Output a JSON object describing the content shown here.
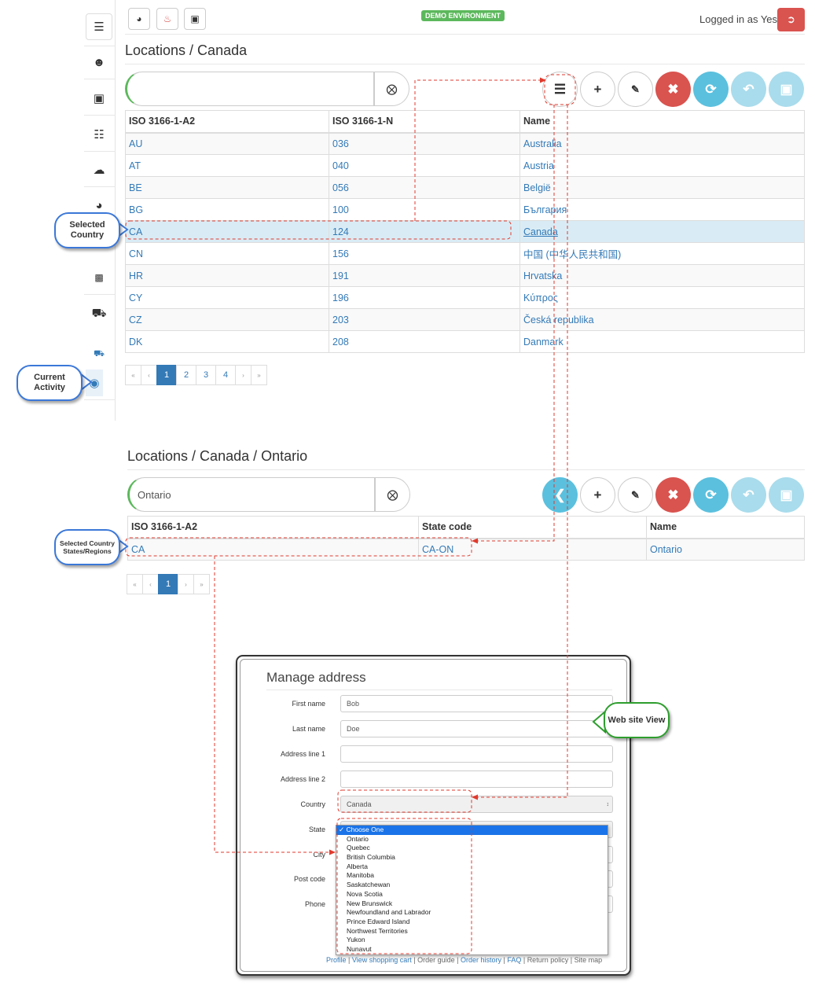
{
  "topbar": {
    "demo_badge": "DEMO ENVIRONMENT",
    "logged_in_text": "Logged in as Yes"
  },
  "countries_view": {
    "breadcrumb": "Locations / Canada",
    "search_value": "",
    "columns": [
      "ISO 3166-1-A2",
      "ISO 3166-1-N",
      "Name"
    ],
    "rows": [
      [
        "AU",
        "036",
        "Australia"
      ],
      [
        "AT",
        "040",
        "Austria"
      ],
      [
        "BE",
        "056",
        "België"
      ],
      [
        "BG",
        "100",
        "България"
      ],
      [
        "CA",
        "124",
        "Canada"
      ],
      [
        "CN",
        "156",
        "中国 (中华人民共和国)"
      ],
      [
        "HR",
        "191",
        "Hrvatska"
      ],
      [
        "CY",
        "196",
        "Κύπρος"
      ],
      [
        "CZ",
        "203",
        "Česká republika"
      ],
      [
        "DK",
        "208",
        "Danmark"
      ]
    ],
    "selected_row": 4,
    "pagination": {
      "first": "«",
      "prev": "‹",
      "pages": [
        "1",
        "2",
        "3",
        "4"
      ],
      "active": "1",
      "next": "›",
      "last": "»"
    }
  },
  "states_view": {
    "breadcrumb": "Locations / Canada / Ontario",
    "search_value": "Ontario",
    "columns": [
      "ISO 3166-1-A2",
      "State code",
      "Name"
    ],
    "rows": [
      [
        "CA",
        "CA-ON",
        "Ontario"
      ]
    ],
    "pagination": {
      "first": "«",
      "prev": "‹",
      "pages": [
        "1"
      ],
      "active": "1",
      "next": "›",
      "last": "»"
    }
  },
  "callouts": {
    "selected_country": "Selected Country",
    "current_activity": "Current Activity",
    "selected_country_states": "Selected Country States/Regions",
    "website_view": "Web site View"
  },
  "website": {
    "title": "Manage address",
    "fields": [
      {
        "label": "First name",
        "value": "Bob"
      },
      {
        "label": "Last name",
        "value": "Doe"
      },
      {
        "label": "Address line 1",
        "value": ""
      },
      {
        "label": "Address line 2",
        "value": ""
      },
      {
        "label": "Country",
        "value": "Canada"
      },
      {
        "label": "State",
        "value": ""
      },
      {
        "label": "City",
        "value": ""
      },
      {
        "label": "Post code",
        "value": ""
      },
      {
        "label": "Phone",
        "value": ""
      }
    ],
    "state_options": [
      "Choose One",
      "Ontario",
      "Quebec",
      "British Columbia",
      "Alberta",
      "Manitoba",
      "Saskatchewan",
      "Nova Scotia",
      "New Brunswick",
      "Newfoundland and Labrador",
      "Prince Edward Island",
      "Northwest Territories",
      "Yukon",
      "Nunavut"
    ],
    "selected_state_option": "Choose One",
    "footer_links": [
      "Profile",
      "View shopping cart",
      "Order guide",
      "Order history",
      "FAQ",
      "Return policy",
      "Site map"
    ]
  },
  "colors": {
    "primary": "#337ab7",
    "danger": "#d9534f",
    "info": "#5bc0de",
    "success": "#5cb85c",
    "annotation_red": "#e03a2e",
    "callout_blue": "#3b78d8",
    "callout_green": "#2e9e2e"
  }
}
